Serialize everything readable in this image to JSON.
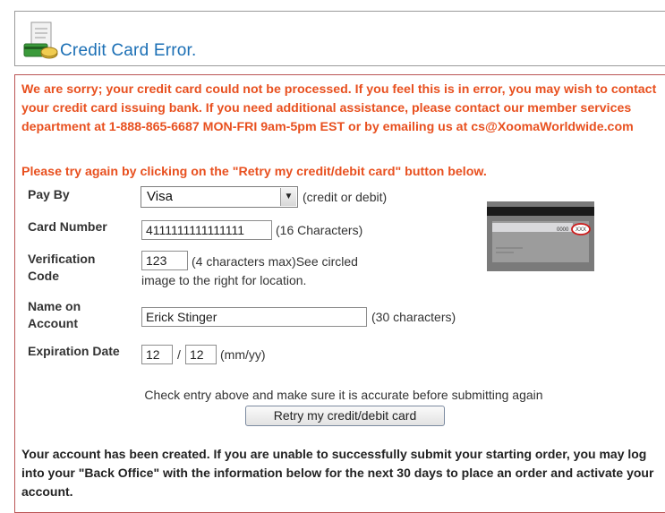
{
  "header": {
    "title": "Credit Card Error."
  },
  "error": {
    "message": "We are sorry; your credit card could not be processed. If you feel this is in error, you may wish to contact your credit card issuing bank. If you need additional assistance, please contact our member services department at 1-888-865-6687 MON-FRI 9am-5pm EST or by emailing us at cs@XoomaWorldwide.com",
    "retry_prompt": "Please try again by clicking on the \"Retry my credit/debit card\" button below."
  },
  "form": {
    "pay_by": {
      "label": "Pay By",
      "value": "Visa",
      "hint": "(credit or debit)"
    },
    "card_number": {
      "label": "Card Number",
      "value": "4111111111111111",
      "hint": "(16 Characters)"
    },
    "verification": {
      "label_line1": "Verification",
      "label_line2": "Code",
      "value": "123",
      "hint_line1": "(4 characters max)See circled",
      "hint_line2": "image to the right for location."
    },
    "name": {
      "label_line1": "Name on",
      "label_line2": "Account",
      "value": "Erick Stinger",
      "hint": "(30 characters)"
    },
    "expiration": {
      "label": "Expiration Date",
      "month": "12",
      "separator": "/",
      "year": "12",
      "hint": "(mm/yy)"
    },
    "card_image": {
      "digits": "0000",
      "cvv": "XXX"
    }
  },
  "submit": {
    "check_text": "Check entry above and make sure it is accurate before submitting again",
    "retry_label": "Retry my credit/debit card"
  },
  "footer": {
    "message": "Your account has been created. If you are unable to successfully submit your starting order, you may log into your \"Back Office\" with the information below for the next 30 days to place an order and activate your account."
  },
  "colors": {
    "title_blue": "#1b6fb5",
    "error_orange": "#e8501f"
  }
}
